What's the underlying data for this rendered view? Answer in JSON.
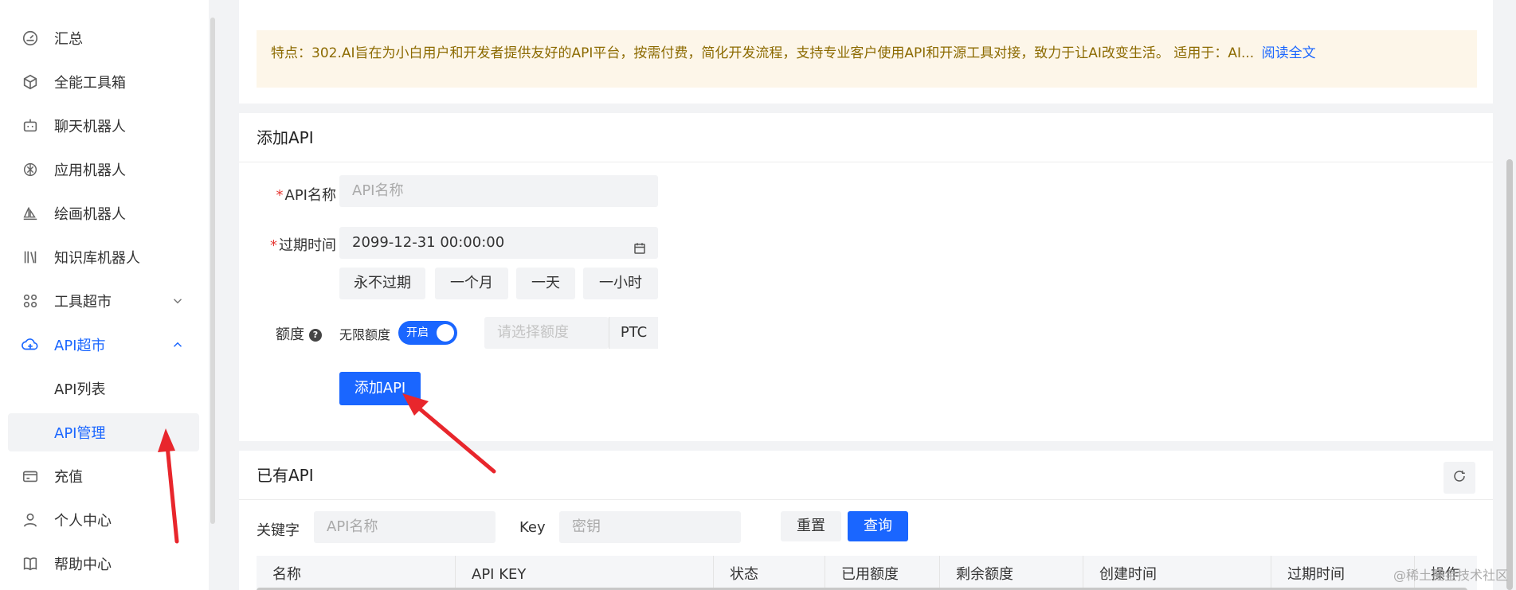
{
  "sidebar": {
    "items": [
      {
        "label": "汇总",
        "icon": "dashboard-icon"
      },
      {
        "label": "全能工具箱",
        "icon": "cube-icon"
      },
      {
        "label": "聊天机器人",
        "icon": "robot-icon"
      },
      {
        "label": "应用机器人",
        "icon": "openai-icon"
      },
      {
        "label": "绘画机器人",
        "icon": "sailboat-icon"
      },
      {
        "label": "知识库机器人",
        "icon": "books-icon"
      },
      {
        "label": "工具超市",
        "icon": "grid-icon"
      },
      {
        "label": "API超市",
        "icon": "cloud-icon"
      }
    ],
    "sub_items": [
      {
        "label": "API列表"
      },
      {
        "label": "API管理"
      }
    ],
    "bottom_items": [
      {
        "label": "充值",
        "icon": "wallet-icon"
      },
      {
        "label": "个人中心",
        "icon": "user-icon"
      },
      {
        "label": "帮助中心",
        "icon": "book-icon"
      }
    ]
  },
  "top_card": {
    "notice_text": "特点：302.AI旨在为小白用户和开发者提供友好的API平台，按需付费，简化开发流程，支持专业客户使用API和开源工具对接，致力于让AI改变生活。 适用于：AI...",
    "read_more": "阅读全文"
  },
  "add_api": {
    "title": "添加API",
    "name_label": "API名称",
    "name_placeholder": "API名称",
    "expire_label": "过期时间",
    "expire_value": "2099-12-31 00:00:00",
    "quick_options": [
      "永不过期",
      "一个月",
      "一天",
      "一小时"
    ],
    "quota_label": "额度",
    "unlimited_label": "无限额度",
    "toggle_label": "开启",
    "toggle_on": true,
    "quota_placeholder": "请选择额度",
    "quota_unit": "PTC",
    "submit_label": "添加API"
  },
  "existing_api": {
    "title": "已有API",
    "keyword_label": "关键字",
    "keyword_placeholder": "API名称",
    "key_label": "Key",
    "key_placeholder": "密钥",
    "reset_label": "重置",
    "search_label": "查询",
    "columns": [
      "名称",
      "API KEY",
      "状态",
      "已用额度",
      "剩余额度",
      "创建时间",
      "过期时间",
      "操作"
    ]
  },
  "watermark": "@稀土掘金技术社区",
  "colors": {
    "accent": "#1a66ff",
    "annotation": "#e8262c",
    "notice_bg": "#fdf6e9"
  }
}
